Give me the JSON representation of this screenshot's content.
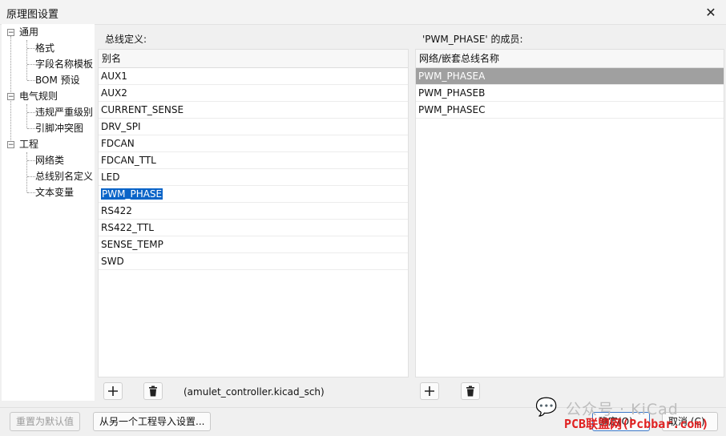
{
  "window": {
    "title": "原理图设置"
  },
  "tree": {
    "groups": [
      {
        "label": "通用",
        "children": [
          "格式",
          "字段名称模板",
          "BOM 预设"
        ]
      },
      {
        "label": "电气规则",
        "children": [
          "违规严重级别",
          "引脚冲突图"
        ]
      },
      {
        "label": "工程",
        "children": [
          "网络类",
          "总线别名定义",
          "文本变量"
        ]
      }
    ]
  },
  "bus_panel": {
    "section_label": "总线定义:",
    "column_header": "别名",
    "rows": [
      "AUX1",
      "AUX2",
      "CURRENT_SENSE",
      "DRV_SPI",
      "FDCAN",
      "FDCAN_TTL",
      "LED",
      "PWM_PHASE",
      "RS422",
      "RS422_TTL",
      "SENSE_TEMP",
      "SWD"
    ],
    "selected_index": 7,
    "filename": "(amulet_controller.kicad_sch)"
  },
  "members_panel": {
    "section_label": "'PWM_PHASE' 的成员:",
    "column_header": "网络/嵌套总线名称",
    "rows": [
      "PWM_PHASEA",
      "PWM_PHASEB",
      "PWM_PHASEC"
    ],
    "selected_index": 0
  },
  "footer": {
    "reset_label": "重置为默认值",
    "import_label": "从另一个工程导入设置...",
    "ok_label": "确定(O)",
    "cancel_label": "取消 (C)"
  },
  "watermark": {
    "text": "公众号 · KiCad",
    "red_text": "PCB联盟网(Pcbbar.com)"
  }
}
